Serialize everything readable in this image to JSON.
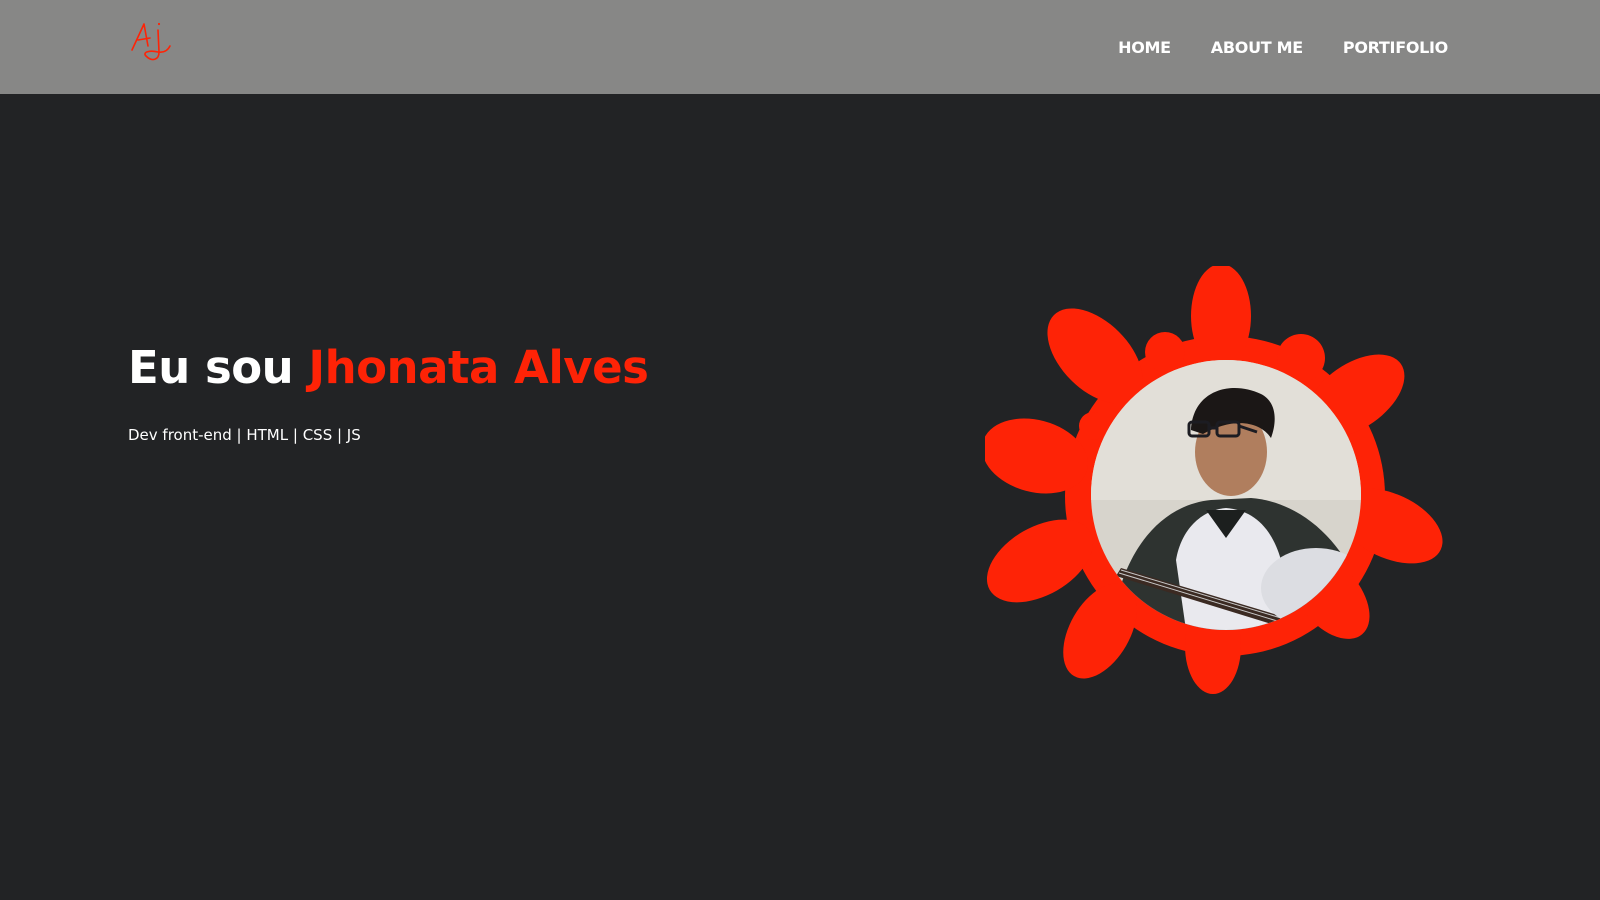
{
  "header": {
    "logo_text": "AJ",
    "nav": [
      {
        "label": "HOME"
      },
      {
        "label": "ABOUT ME"
      },
      {
        "label": "PORTIFOLIO"
      }
    ]
  },
  "hero": {
    "title_prefix": "Eu sou",
    "title_name": "Jhonata Alves",
    "subtitle": "Dev front-end | HTML | CSS | JS"
  },
  "colors": {
    "header_bg": "#878786",
    "page_bg": "#222325",
    "accent": "#fe2306",
    "text": "#ffffff"
  }
}
